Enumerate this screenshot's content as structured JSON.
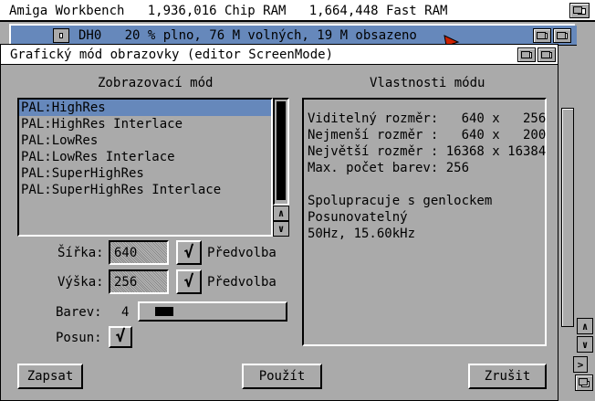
{
  "screen": {
    "title": "Amiga Workbench   1,936,016 Chip RAM   1,664,448 Fast RAM"
  },
  "drive_window": {
    "title": "DH0   20 % plno, 76 M volných, 19 M obsazeno"
  },
  "dialog": {
    "title": "Grafický mód obrazovky (editor ScreenMode)",
    "display_mode": {
      "heading": "Zobrazovací mód",
      "selected": "PAL:HighRes",
      "items": [
        "PAL:HighRes",
        "PAL:HighRes Interlace",
        "PAL:LowRes",
        "PAL:LowRes Interlace",
        "PAL:SuperHighRes",
        "PAL:SuperHighRes Interlace"
      ]
    },
    "properties": {
      "heading": "Vlastnosti módu",
      "lines": [
        "Viditelný rozměr:   640 x   256",
        "Nejmenší rozměr :   640 x   200",
        "Největší rozměr : 16368 x 16384",
        "Max. počet barev: 256",
        "",
        "Spolupracuje s genlockem",
        "Posunovatelný",
        "50Hz, 15.60kHz"
      ]
    },
    "width": {
      "label": "Šířka:",
      "value": "640",
      "default_label": "Předvolba",
      "default_checked": true
    },
    "height": {
      "label": "Výška:",
      "value": "256",
      "default_label": "Předvolba",
      "default_checked": true
    },
    "colors": {
      "label": "Barev:",
      "value": "4",
      "slider_level": 0.1
    },
    "scroll": {
      "label": "Posun:",
      "checked": true
    },
    "buttons": {
      "save": "Zapsat",
      "use": "Použít",
      "cancel": "Zrušit"
    },
    "check_glyph": "√"
  },
  "colors": {
    "workbench_gray": "#aaaaaa",
    "title_blue": "#6688bb",
    "selection_blue": "#6688bb",
    "pointer_red": "#cc2200"
  }
}
